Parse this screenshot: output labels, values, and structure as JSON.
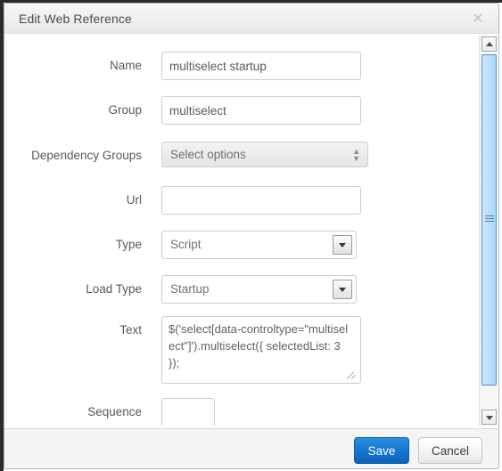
{
  "dialog": {
    "title": "Edit Web Reference",
    "close_label": "×"
  },
  "form": {
    "name": {
      "label": "Name",
      "value": "multiselect startup",
      "placeholder": ""
    },
    "group": {
      "label": "Group",
      "value": "multiselect",
      "placeholder": ""
    },
    "dependency_groups": {
      "label": "Dependency Groups",
      "value": "Select options",
      "options": [
        "Select options"
      ]
    },
    "url": {
      "label": "Url",
      "value": "",
      "placeholder": ""
    },
    "type": {
      "label": "Type",
      "value": "Script",
      "options": [
        "Script"
      ]
    },
    "load_type": {
      "label": "Load Type",
      "value": "Startup",
      "options": [
        "Startup"
      ]
    },
    "text": {
      "label": "Text",
      "value": "$('select[data-controltype=\"multiselect\"]').multiselect({ selectedList: 3 });"
    },
    "sequence": {
      "label": "Sequence",
      "value": "",
      "placeholder": ""
    }
  },
  "footer": {
    "save_label": "Save",
    "cancel_label": "Cancel"
  },
  "colors": {
    "accent": "#1577cd",
    "scrollbar_thumb": "#bfe0fb",
    "titlebar": "#efefef",
    "footer": "#f4f4f4"
  }
}
